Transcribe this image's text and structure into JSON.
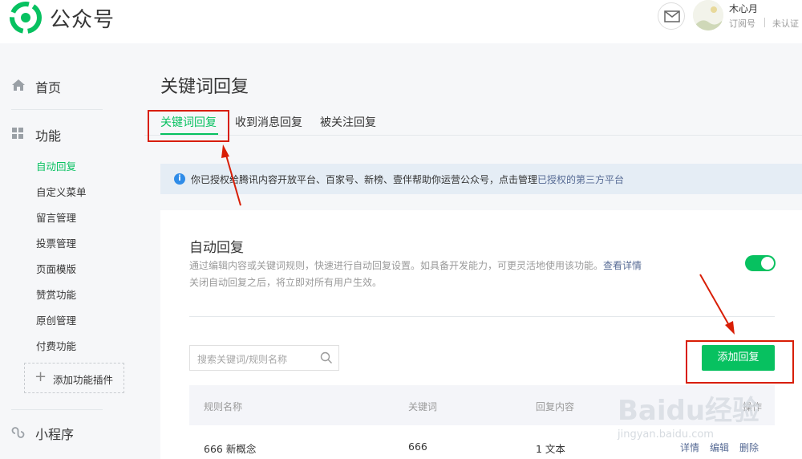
{
  "header": {
    "brand": "公众号",
    "account_name": "木心月",
    "account_type": "订阅号",
    "verify_status": "未认证",
    "logo_icon": "wechat-official-logo",
    "mail_icon": "mail-icon",
    "accent": "#07c160"
  },
  "sidebar": {
    "home": "首页",
    "function": "功能",
    "items": [
      {
        "label": "自动回复",
        "active": true
      },
      {
        "label": "自定义菜单"
      },
      {
        "label": "留言管理"
      },
      {
        "label": "投票管理"
      },
      {
        "label": "页面模版"
      },
      {
        "label": "赞赏功能"
      },
      {
        "label": "原创管理"
      },
      {
        "label": "付费功能"
      }
    ],
    "add_plugin": "添加功能插件",
    "mini_program": "小程序"
  },
  "main": {
    "title": "关键词回复",
    "tabs": [
      {
        "label": "关键词回复",
        "active": true
      },
      {
        "label": "收到消息回复"
      },
      {
        "label": "被关注回复"
      }
    ],
    "info": {
      "text": "你已授权给腾讯内容开放平台、百家号、新榜、壹伴帮助你运营公众号，点击管理",
      "link": "已授权的第三方平台"
    },
    "auto_reply": {
      "title": "自动回复",
      "desc1": "通过编辑内容或关键词规则，快速进行自动回复设置。如具备开发能力，可更灵活地使用该功能。",
      "desc_link": "查看详情",
      "desc2": "关闭自动回复之后，将立即对所有用户生效。",
      "enabled": true
    },
    "search": {
      "placeholder": "搜索关键词/规则名称"
    },
    "add_button": "添加回复",
    "table": {
      "headers": [
        "规则名称",
        "关键词",
        "回复内容",
        "操作"
      ],
      "rows": [
        {
          "name": "666 新概念",
          "keyword": "666",
          "reply": "1 文本",
          "actions": [
            "详情",
            "编辑",
            "删除"
          ]
        }
      ]
    }
  },
  "watermark": {
    "brand": "Baidu经验",
    "url": "jingyan.baidu.com"
  }
}
